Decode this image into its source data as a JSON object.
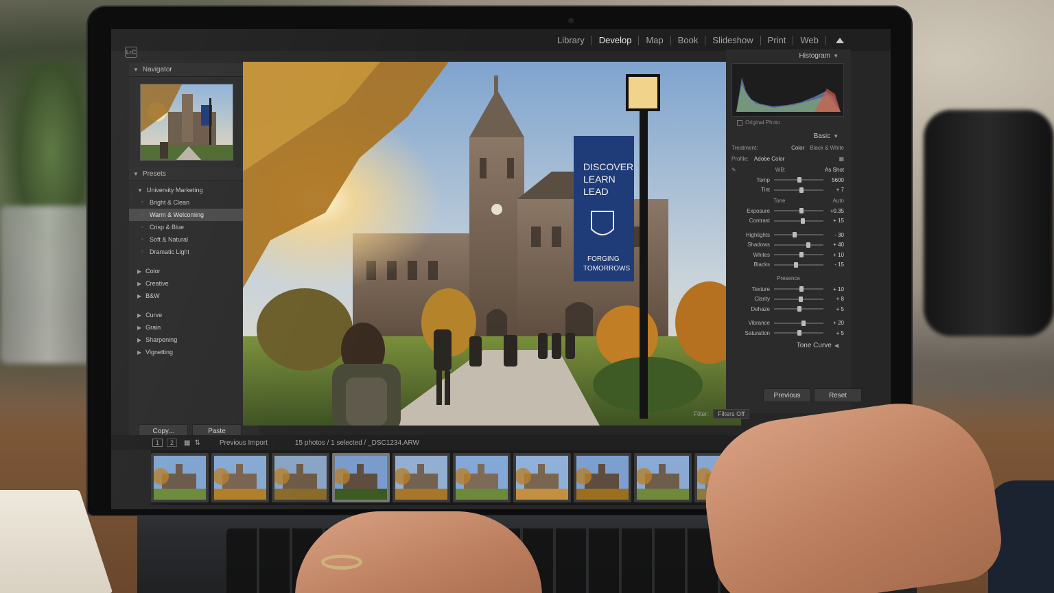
{
  "app": {
    "logo": "LrC",
    "modules": [
      "Library",
      "Develop",
      "Map",
      "Book",
      "Slideshow",
      "Print",
      "Web"
    ],
    "active_module": "Develop"
  },
  "left_panel": {
    "navigator_title": "Navigator",
    "presets_title": "Presets",
    "preset_group": "University Marketing",
    "preset_items": [
      "Bright & Clean",
      "Warm & Welcoming",
      "Crisp & Blue",
      "Soft & Natural",
      "Dramatic Light"
    ],
    "selected_preset": "Warm & Welcoming",
    "folders_a": [
      "Color",
      "Creative",
      "B&W"
    ],
    "folders_b": [
      "Curve",
      "Grain",
      "Sharpening",
      "Vignetting"
    ],
    "copy_label": "Copy...",
    "paste_label": "Paste"
  },
  "photo": {
    "banner_line1": "DISCOVER",
    "banner_line2": "LEARN",
    "banner_line3": "LEAD",
    "banner_footer1": "FORGING",
    "banner_footer2": "TOMORROWS"
  },
  "right_panel": {
    "histogram_title": "Histogram",
    "original_photo": "Original Photo",
    "basic_title": "Basic",
    "treatment_label": "Treatment:",
    "treatment_color": "Color",
    "treatment_bw": "Black & White",
    "profile_label": "Profile:",
    "profile_value": "Adobe Color",
    "wb_label": "WB:",
    "wb_value": "As Shot",
    "tone_label": "Tone",
    "auto_label": "Auto",
    "presence_label": "Presence",
    "tone_curve_title": "Tone Curve",
    "previous_label": "Previous",
    "reset_label": "Reset",
    "sliders_wb": [
      {
        "label": "Temp",
        "value": "5600",
        "pos": 0.52
      },
      {
        "label": "Tint",
        "value": "+ 7",
        "pos": 0.56
      }
    ],
    "sliders_tone": [
      {
        "label": "Exposure",
        "value": "+0.35",
        "pos": 0.56
      },
      {
        "label": "Contrast",
        "value": "+ 15",
        "pos": 0.58
      }
    ],
    "sliders_tone2": [
      {
        "label": "Highlights",
        "value": "- 30",
        "pos": 0.42
      },
      {
        "label": "Shadows",
        "value": "+ 40",
        "pos": 0.7
      },
      {
        "label": "Whites",
        "value": "+ 10",
        "pos": 0.55
      },
      {
        "label": "Blacks",
        "value": "- 15",
        "pos": 0.45
      }
    ],
    "sliders_presence": [
      {
        "label": "Texture",
        "value": "+ 10",
        "pos": 0.55
      },
      {
        "label": "Clarity",
        "value": "+ 8",
        "pos": 0.54
      },
      {
        "label": "Dehaze",
        "value": "+ 5",
        "pos": 0.52
      }
    ],
    "sliders_color": [
      {
        "label": "Vibrance",
        "value": "+ 20",
        "pos": 0.6
      },
      {
        "label": "Saturation",
        "value": "+ 5",
        "pos": 0.52
      }
    ]
  },
  "filmstrip": {
    "source": "Previous Import",
    "count": "15 photos / 1 selected / _DSC1234.ARW",
    "filter_label": "Filter:",
    "filter_value": "Filters Off",
    "page1": "1",
    "page2": "2",
    "selected_index": 3
  }
}
